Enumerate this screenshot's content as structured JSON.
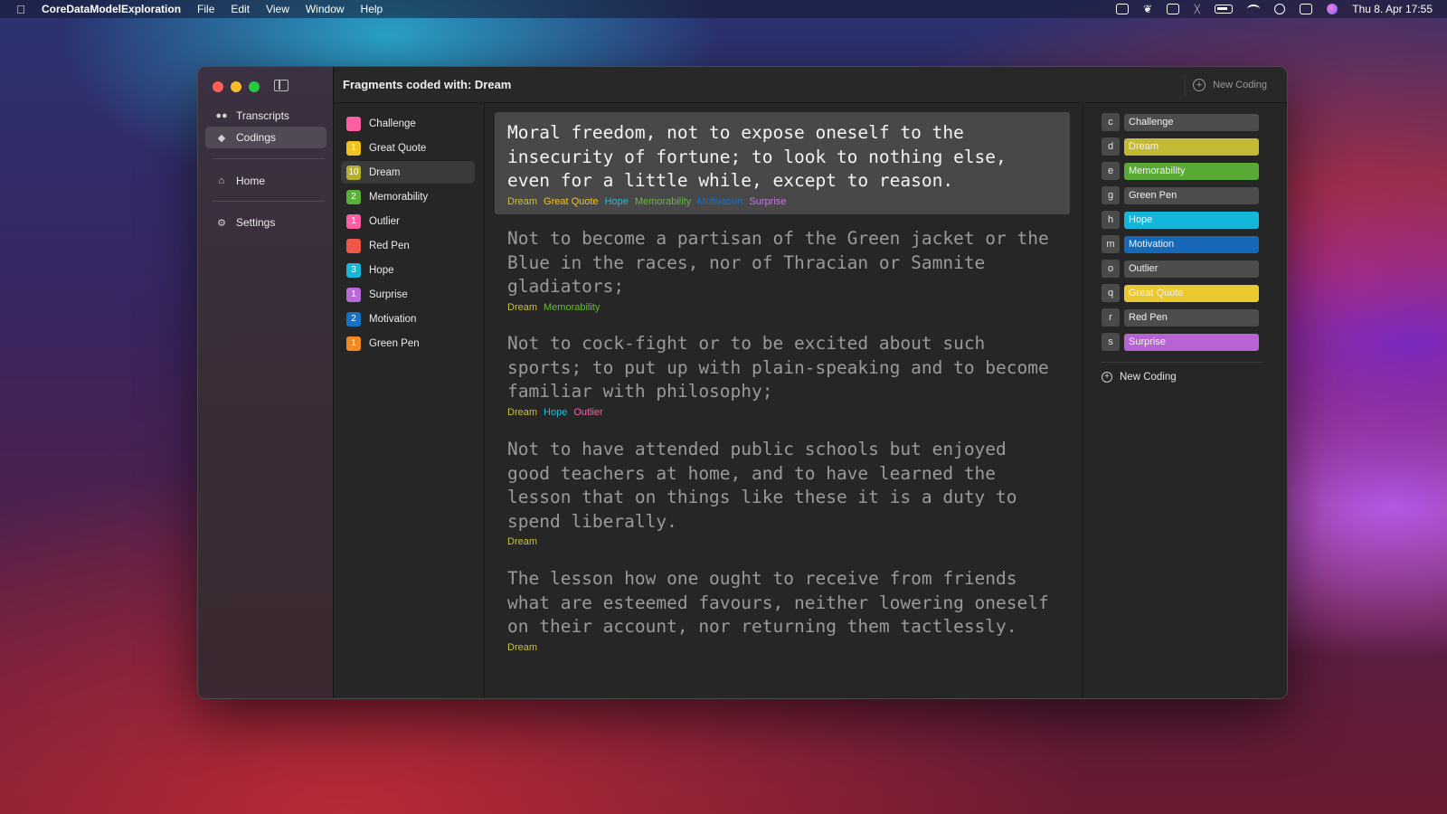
{
  "menubar": {
    "app_name": "CoreDataModelExploration",
    "menus": [
      "File",
      "Edit",
      "View",
      "Window",
      "Help"
    ],
    "clock": "Thu 8. Apr  17:55"
  },
  "sidebar": {
    "items": [
      {
        "label": "Transcripts",
        "icon": "people-icon"
      },
      {
        "label": "Codings",
        "icon": "tag-icon"
      },
      {
        "label": "Home",
        "icon": "house-icon"
      },
      {
        "label": "Settings",
        "icon": "gear-icon"
      }
    ],
    "selected": "Codings"
  },
  "header": {
    "title": "Fragments coded with: Dream",
    "new_coding_label": "New Coding"
  },
  "codings": [
    {
      "name": "Challenge",
      "count": "",
      "color": "#ff5fa2"
    },
    {
      "name": "Great Quote",
      "count": "1",
      "color": "#f2c31c"
    },
    {
      "name": "Dream",
      "count": "10",
      "color": "#b8b02a"
    },
    {
      "name": "Memorability",
      "count": "2",
      "color": "#5bb03a"
    },
    {
      "name": "Outlier",
      "count": "1",
      "color": "#ff5fa2"
    },
    {
      "name": "Red Pen",
      "count": "",
      "color": "#f0574a"
    },
    {
      "name": "Hope",
      "count": "3",
      "color": "#16b8d8"
    },
    {
      "name": "Surprise",
      "count": "1",
      "color": "#b86ad6"
    },
    {
      "name": "Motivation",
      "count": "2",
      "color": "#1672c4"
    },
    {
      "name": "Green Pen",
      "count": "1",
      "color": "#f28a24"
    }
  ],
  "selected_coding": "Dream",
  "fragments": [
    {
      "text": "Moral freedom, not to expose oneself to the insecurity of fortune; to look to nothing else, even for a little while, except to reason.",
      "tags": [
        {
          "name": "Dream",
          "color": "#c9c233"
        },
        {
          "name": "Great Quote",
          "color": "#f2c31c"
        },
        {
          "name": "Hope",
          "color": "#1cc0e0"
        },
        {
          "name": "Memorability",
          "color": "#6ab83e"
        },
        {
          "name": "Motivation",
          "color": "#1b6fbd"
        },
        {
          "name": "Surprise",
          "color": "#c27ce0"
        }
      ]
    },
    {
      "text": "Not to become a partisan of the Green jacket or the Blue in the races, nor of Thracian or Samnite gladiators;",
      "tags": [
        {
          "name": "Dream",
          "color": "#c9c233"
        },
        {
          "name": "Memorability",
          "color": "#6ab83e"
        }
      ]
    },
    {
      "text": "Not to cock-fight or to be excited about such sports; to put up with plain-speaking and to become familiar with philosophy;",
      "tags": [
        {
          "name": "Dream",
          "color": "#c9c233"
        },
        {
          "name": "Hope",
          "color": "#1cc0e0"
        },
        {
          "name": "Outlier",
          "color": "#ff5fa2"
        }
      ]
    },
    {
      "text": "Not to have attended public schools but enjoyed good teachers at home, and to have learned the lesson that on things like these it is a duty to spend liberally.",
      "tags": [
        {
          "name": "Dream",
          "color": "#c9c233"
        }
      ]
    },
    {
      "text": "The lesson how one ought to receive from friends what are esteemed favours, neither lowering oneself on their account, nor returning them tactlessly.",
      "tags": [
        {
          "name": "Dream",
          "color": "#c9c233"
        }
      ]
    }
  ],
  "shortcuts": [
    {
      "key": "c",
      "name": "Challenge",
      "color": "#4d4d4d"
    },
    {
      "key": "d",
      "name": "Dream",
      "color": "#c2b935"
    },
    {
      "key": "e",
      "name": "Memorability",
      "color": "#5aa935"
    },
    {
      "key": "g",
      "name": "Green Pen",
      "color": "#4d4d4d"
    },
    {
      "key": "h",
      "name": "Hope",
      "color": "#14b6d9"
    },
    {
      "key": "m",
      "name": "Motivation",
      "color": "#1769b8"
    },
    {
      "key": "o",
      "name": "Outlier",
      "color": "#4d4d4d"
    },
    {
      "key": "q",
      "name": "Great Quote",
      "color": "#e9c92f"
    },
    {
      "key": "r",
      "name": "Red Pen",
      "color": "#4d4d4d"
    },
    {
      "key": "s",
      "name": "Surprise",
      "color": "#b763d4"
    }
  ],
  "new_coding_bottom_label": "New Coding"
}
